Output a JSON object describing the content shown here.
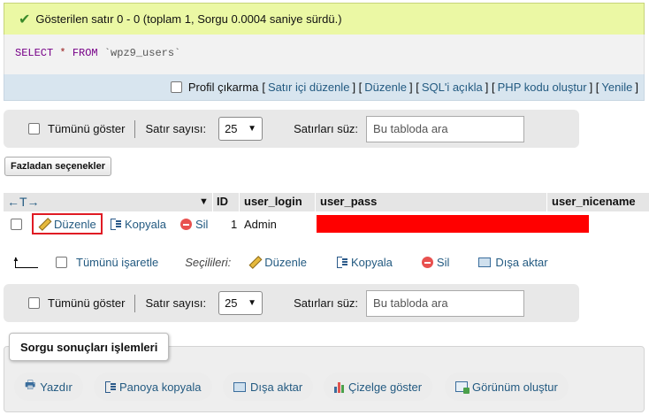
{
  "message": {
    "text": "Gösterilen satır 0 - 0 (toplam 1, Sorgu 0.0004 saniye sürdü.)",
    "icon": "check-icon"
  },
  "sql": {
    "select": "SELECT",
    "star": "*",
    "from": "FROM",
    "table": "`wpz9_users`"
  },
  "sql_links": {
    "profile": "Profil çıkarma",
    "open1": "[",
    "inline_edit": "Satır içi düzenle",
    "sep1": "] [",
    "edit": "Düzenle",
    "sep2": "] [",
    "explain": "SQL'i açıkla",
    "sep3": "] [",
    "php": "PHP kodu oluştur",
    "sep4": "] [",
    "refresh": "Yenile",
    "close": "]"
  },
  "navbar": {
    "show_all": "Tümünü göster",
    "rows_label": "Satır sayısı:",
    "rows_value": "25",
    "filter_label": "Satırları süz:",
    "filter_placeholder": "Bu tabloda ara"
  },
  "more_options": "Fazladan seçenekler",
  "table": {
    "columns": [
      "ID",
      "user_login",
      "user_pass",
      "user_nicename"
    ],
    "row": {
      "edit": "Düzenle",
      "copy": "Kopyala",
      "delete": "Sil",
      "id": "1",
      "user_login": "Admin"
    },
    "redact_color": "#ff0000"
  },
  "selection": {
    "check_all": "Tümünü işaretle",
    "selected": "Seçilileri:",
    "edit": "Düzenle",
    "copy": "Kopyala",
    "delete": "Sil",
    "export": "Dışa aktar"
  },
  "query_ops": {
    "title": "Sorgu sonuçları işlemleri",
    "print": "Yazdır",
    "clipboard": "Panoya kopyala",
    "export": "Dışa aktar",
    "chart": "Çizelge göster",
    "view": "Görünüm oluştur"
  }
}
